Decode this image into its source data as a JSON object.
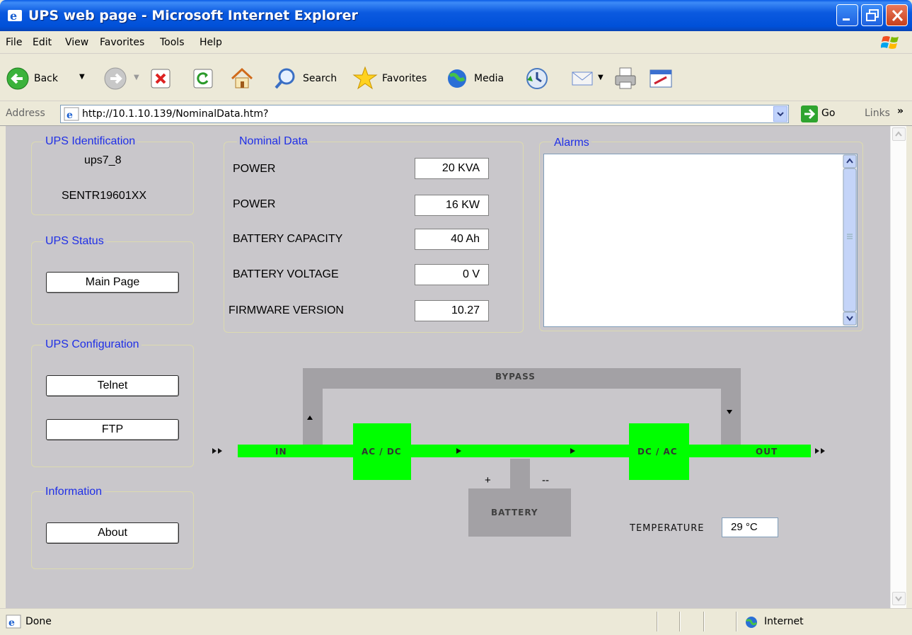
{
  "window": {
    "title": "UPS web page - Microsoft Internet Explorer"
  },
  "menu": {
    "items": [
      "File",
      "Edit",
      "View",
      "Favorites",
      "Tools",
      "Help"
    ]
  },
  "toolbar": {
    "back": "Back",
    "search": "Search",
    "favorites": "Favorites",
    "media": "Media"
  },
  "address": {
    "label": "Address",
    "url": "http://10.1.10.139/NominalData.htm?",
    "go": "Go",
    "links": "Links"
  },
  "identification": {
    "legend": "UPS Identification",
    "name": "ups7_8",
    "serial": "SENTR19601XX"
  },
  "status": {
    "legend": "UPS Status",
    "main_page": "Main Page"
  },
  "configuration": {
    "legend": "UPS Configuration",
    "telnet": "Telnet",
    "ftp": "FTP"
  },
  "information": {
    "legend": "Information",
    "about": "About"
  },
  "nominal": {
    "legend": "Nominal Data",
    "rows": [
      {
        "label": "POWER",
        "value": "20 KVA"
      },
      {
        "label": "POWER",
        "value": "16 KW"
      },
      {
        "label": "BATTERY CAPACITY",
        "value": "40 Ah"
      },
      {
        "label": "BATTERY VOLTAGE",
        "value": "0 V"
      },
      {
        "label": "FIRMWARE VERSION",
        "value": "10.27"
      }
    ]
  },
  "alarms": {
    "legend": "Alarms"
  },
  "diagram": {
    "bypass": "BYPASS",
    "in": "IN",
    "acdc": "AC / DC",
    "dcac": "DC / AC",
    "out": "OUT",
    "battery": "BATTERY",
    "plus": "+",
    "minus": "--",
    "temperature_label": "TEMPERATURE",
    "temperature_value": "29 °C",
    "colors": {
      "line": "#00ff00",
      "bypass": "#a3a1a5"
    }
  },
  "statusbar": {
    "text": "Done",
    "zone": "Internet"
  }
}
